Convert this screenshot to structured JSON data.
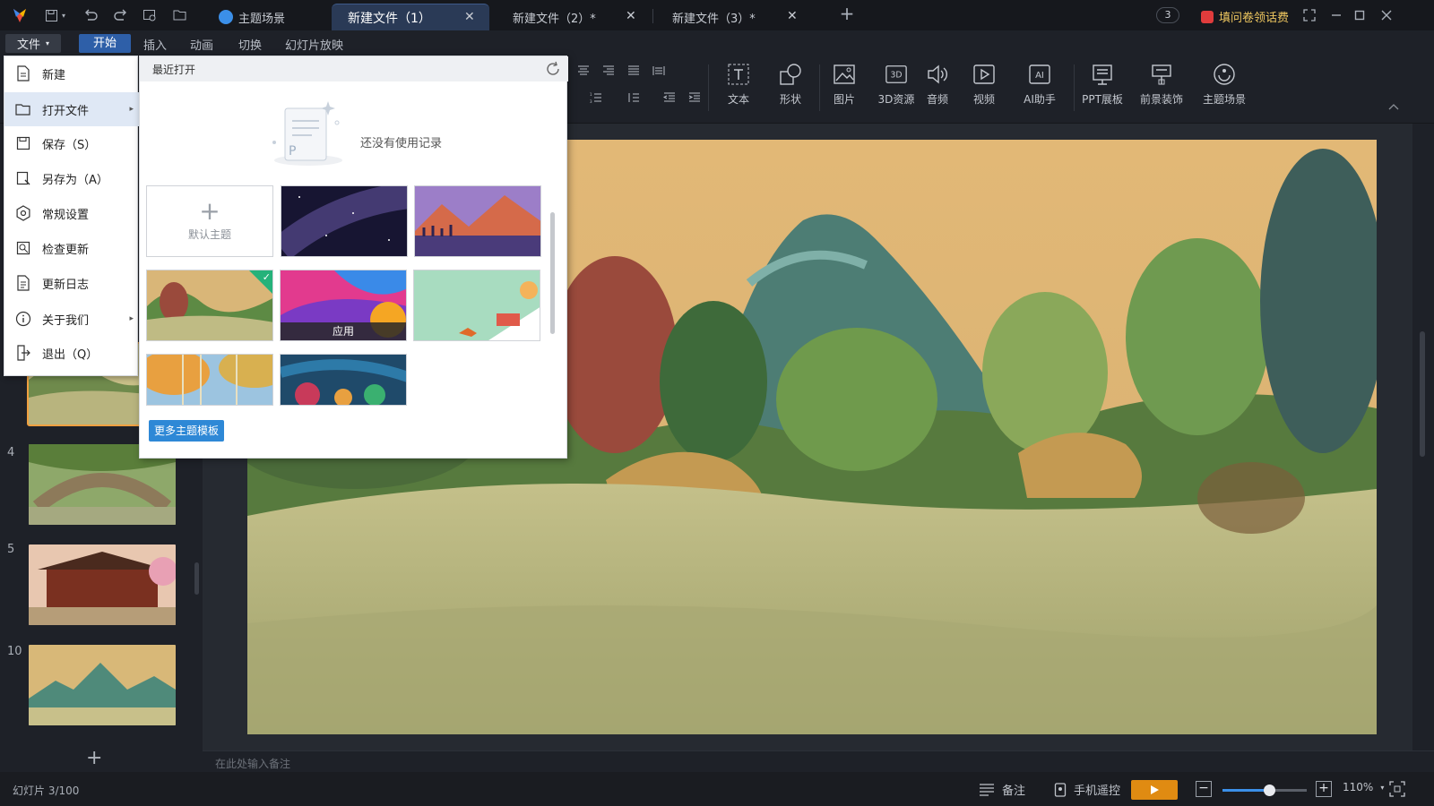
{
  "titlebar": {
    "tabs": [
      {
        "label": "主题场景"
      },
      {
        "label": "新建文件（1）"
      },
      {
        "label": "新建文件（2）*"
      },
      {
        "label": "新建文件（3）*"
      }
    ],
    "notification_count": "3",
    "promo_label": "填问卷领话费"
  },
  "menubar": {
    "file_label": "文件",
    "items": [
      "开始",
      "插入",
      "动画",
      "切换",
      "幻灯片放映"
    ]
  },
  "ribbon": {
    "buttons": [
      {
        "label": "文本",
        "icon": "text-box-icon"
      },
      {
        "label": "形状",
        "icon": "shape-icon"
      },
      {
        "label": "图片",
        "icon": "image-icon"
      },
      {
        "label": "3D资源",
        "icon": "3d-icon"
      },
      {
        "label": "音频",
        "icon": "audio-icon"
      },
      {
        "label": "视频",
        "icon": "video-icon"
      },
      {
        "label": "AI助手",
        "icon": "ai-icon"
      },
      {
        "label": "PPT展板",
        "icon": "board-icon"
      },
      {
        "label": "前景装饰",
        "icon": "decor-icon"
      },
      {
        "label": "主题场景",
        "icon": "theme-scene-icon"
      }
    ],
    "icon_3d_text": "3D",
    "icon_ai_text": "AI"
  },
  "file_menu": {
    "items": [
      {
        "label": "新建",
        "icon": "new-file-icon"
      },
      {
        "label": "打开文件",
        "icon": "folder-open-icon",
        "submenu": true
      },
      {
        "label": "保存（S）",
        "icon": "save-icon"
      },
      {
        "label": "另存为（A）",
        "icon": "save-as-icon"
      },
      {
        "label": "常规设置",
        "icon": "settings-icon"
      },
      {
        "label": "检查更新",
        "icon": "check-update-icon"
      },
      {
        "label": "更新日志",
        "icon": "changelog-icon"
      },
      {
        "label": "关于我们",
        "icon": "info-icon",
        "submenu": true
      },
      {
        "label": "退出（Q）",
        "icon": "exit-icon"
      }
    ],
    "submenu_arrow": "▸"
  },
  "recent": {
    "title": "最近打开",
    "empty_text": "还没有使用记录",
    "default_theme_label": "默认主题",
    "apply_label": "应用",
    "more_button": "更多主题模板",
    "add_symbol": "+"
  },
  "slides": {
    "numbers": [
      "4",
      "5",
      "10"
    ],
    "add_symbol": "+"
  },
  "notes": {
    "placeholder": "在此处输入备注"
  },
  "status": {
    "slide_info": "幻灯片 3/100",
    "notes_label": "备注",
    "remote_label": "手机遥控",
    "zoom": "110%",
    "zoom_level": 0.55,
    "zoom_minus": "−",
    "zoom_plus": "+"
  },
  "colors": {
    "accent": "#2e5fa8",
    "play": "#e08b12",
    "selected_thumb": "#f0a040",
    "check": "#25b27a"
  }
}
